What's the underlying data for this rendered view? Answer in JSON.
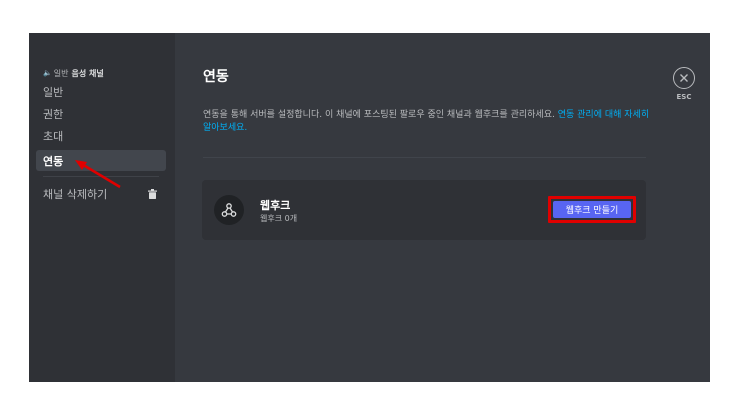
{
  "sidebar": {
    "category": "일반",
    "channel_name": "음성 채널",
    "items": [
      {
        "label": "일반"
      },
      {
        "label": "권한"
      },
      {
        "label": "초대"
      },
      {
        "label": "연동"
      }
    ],
    "delete_label": "채널 삭제하기"
  },
  "main": {
    "title": "연동",
    "description": "연동을 통해 서버를 설정합니다. 이 채널에 포스팅된 팔로우 중인 채널과 웹후크를 관리하세요.",
    "description_link": "연동 관리에 대해 자세히 알아보세요.",
    "webhook_card": {
      "name": "웹후크",
      "count": "웹후크 0개",
      "create_button": "웹후크 만들기"
    }
  },
  "close": {
    "esc_label": "ESC"
  },
  "colors": {
    "accent": "#5865f2",
    "link": "#00aff4",
    "highlight": "#e00000"
  }
}
